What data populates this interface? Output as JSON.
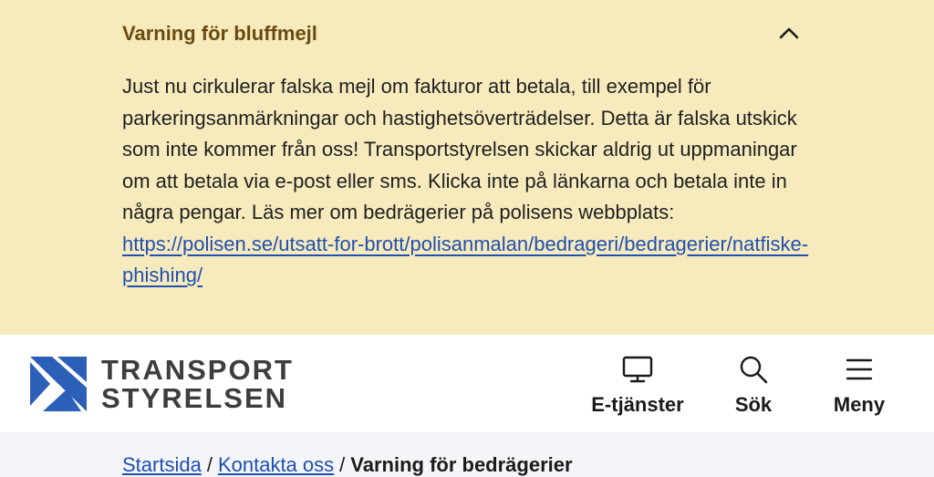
{
  "alert": {
    "title": "Varning för bluffmejl",
    "body": "Just nu cirkulerar falska mejl om fakturor att betala, till exempel för parkeringsanmärkningar och hastighetsöverträdelser. Detta är falska utskick som inte kommer från oss! Transportstyrelsen skickar aldrig ut uppmaningar om att betala via e-post eller sms. Klicka inte på länkarna och betala inte in några pengar. Läs mer om bedrägerier på polisens webbplats: ",
    "link_text": "https://polisen.se/utsatt-for-brott/polisanmalan/bedrageri/bedragerier/natfiske-phishing/",
    "toggle_icon": "chevron-up-icon",
    "background": "#f7ebbd",
    "title_color": "#6b4a12"
  },
  "header": {
    "logo_line1": "TRANSPORT",
    "logo_line2": "STYRELSEN",
    "brand_color": "#2c5fb8",
    "nav": {
      "etjanster": "E-tjänster",
      "sok": "Sök",
      "meny": "Meny"
    }
  },
  "breadcrumb": {
    "item1": "Startsida",
    "item2": "Kontakta oss",
    "current": "Varning för bedrägerier",
    "separator": "/"
  }
}
